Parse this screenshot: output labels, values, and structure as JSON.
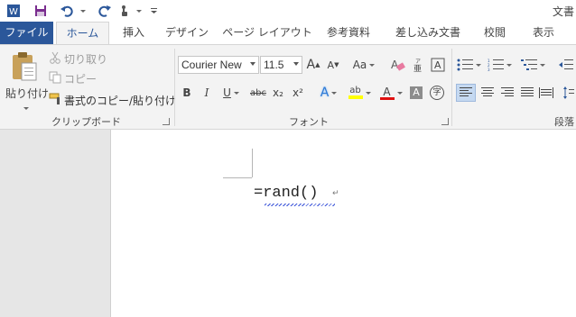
{
  "window": {
    "title": "文書"
  },
  "qat": {
    "icons": [
      "word-logo-icon",
      "save-icon",
      "undo-icon",
      "redo-icon",
      "touch-mode-icon",
      "customize-qat-icon"
    ]
  },
  "tabs": [
    {
      "label": "ファイル",
      "active": false
    },
    {
      "label": "ホーム",
      "active": true
    },
    {
      "label": "挿入",
      "active": false
    },
    {
      "label": "デザイン",
      "active": false
    },
    {
      "label": "ページ レイアウト",
      "active": false
    },
    {
      "label": "参考資料",
      "active": false
    },
    {
      "label": "差し込み文書",
      "active": false
    },
    {
      "label": "校閲",
      "active": false
    },
    {
      "label": "表示",
      "active": false
    }
  ],
  "clipboard": {
    "paste_label": "貼り付け",
    "cut_label": "切り取り",
    "copy_label": "コピー",
    "format_painter_label": "書式のコピー/貼り付け",
    "group_label": "クリップボード"
  },
  "font": {
    "font_name": "Courier New",
    "font_size": "11.5",
    "grow_label": "A",
    "shrink_label": "A",
    "change_case_label": "Aa",
    "bold_label": "B",
    "italic_label": "I",
    "underline_label": "U",
    "strike_label": "abc",
    "subscript_label": "x₂",
    "superscript_label": "x²",
    "text_effects_label": "A",
    "highlight_label": "ab",
    "font_color_label": "A",
    "shading_label": "A",
    "enclose_label": "字",
    "group_label": "フォント",
    "highlight_color": "#ffff00",
    "font_color": "#e01010"
  },
  "paragraph": {
    "group_label": "段落"
  },
  "document": {
    "text": "=rand()",
    "paragraph_mark": "↵"
  },
  "colors": {
    "accent": "#2b579a",
    "page": "#ffffff",
    "ribbon": "#f3f3f3"
  }
}
